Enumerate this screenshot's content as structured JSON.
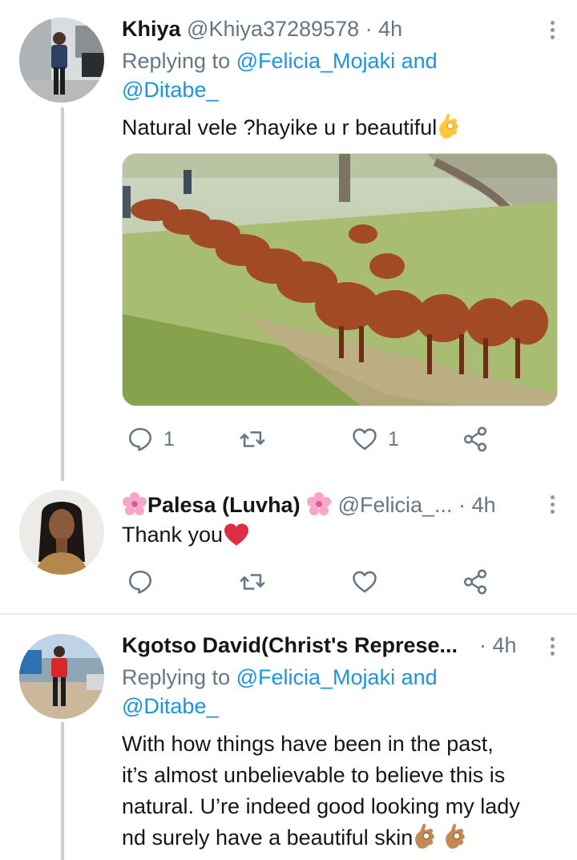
{
  "tweets": [
    {
      "name": "Khiya",
      "handle": "@Khiya37289578",
      "dot": "·",
      "time": "4h",
      "replying_label": "Replying to",
      "reply_user1": "@Felicia_Mojaki",
      "reply_and": "and",
      "reply_user2": "@Ditabe_",
      "text": "Natural vele ?hayike u r beautiful",
      "text_emoji": "ok-hand",
      "reply_count": "1",
      "like_count": "1"
    },
    {
      "name_prefix_emoji": "cherry-blossom",
      "name": "Palesa (Luvha)",
      "name_suffix_emoji": "cherry-blossom",
      "handle": "@Felicia_...",
      "dot": "·",
      "time": "4h",
      "text": "Thank you",
      "text_emoji": "red-heart"
    },
    {
      "name": "Kgotso David(Christ's Represe...",
      "dot": "·",
      "time": "4h",
      "replying_label": "Replying to",
      "reply_user1": "@Felicia_Mojaki",
      "reply_and": "and",
      "reply_user2": "@Ditabe_",
      "text_lines": [
        "With how things have been in the past,",
        "it’s almost unbelievable to believe this is",
        "natural. U’re indeed good looking my lady",
        "nd surely have a beautiful skin"
      ],
      "text_emoji": "ok-hand-medium-skin"
    }
  ],
  "colors": {
    "link": "#1b95e0",
    "muted": "#657786",
    "thread_line": "#c4cfd6"
  }
}
